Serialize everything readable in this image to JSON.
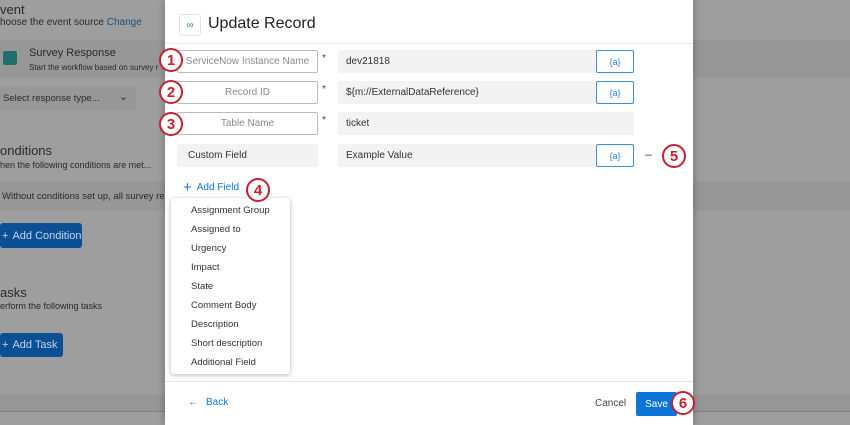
{
  "background": {
    "event_heading": "vent",
    "event_sub": "hoose the event source",
    "change_link": "Change",
    "survey_title": "Survey Response",
    "survey_sub": "Start the workflow based on survey r",
    "select_placeholder": "Select response type...",
    "conditions_heading": "onditions",
    "conditions_sub": "hen the following conditions are met...",
    "conditions_notice": "Without conditions set up, all survey resp",
    "add_condition": "Add Condition",
    "tasks_heading": "asks",
    "tasks_sub": "erform the following tasks",
    "add_task": "Add Task"
  },
  "modal": {
    "title": "Update Record",
    "rows": [
      {
        "label": "ServiceNow Instance Name",
        "required": "*",
        "value": "dev21818",
        "piped": "{a}"
      },
      {
        "label": "Record ID",
        "required": "*",
        "value": "${m://ExternalDataReference}",
        "piped": "{a}"
      },
      {
        "label": "Table Name",
        "required": "*",
        "value": "ticket"
      },
      {
        "label": "Custom Field",
        "value": "Example Value",
        "piped": "{a}",
        "remove": "–"
      }
    ],
    "add_field": "Add Field",
    "dropdown": [
      "Assignment Group",
      "Assigned to",
      "Urgency",
      "Impact",
      "State",
      "Comment Body",
      "Description",
      "Short description",
      "Additional Field"
    ],
    "back": "Back",
    "cancel": "Cancel",
    "save": "Save"
  },
  "badges": [
    "1",
    "2",
    "3",
    "4",
    "5",
    "6"
  ],
  "colors": {
    "accent": "#0b74d6",
    "badge": "#c8202f"
  }
}
